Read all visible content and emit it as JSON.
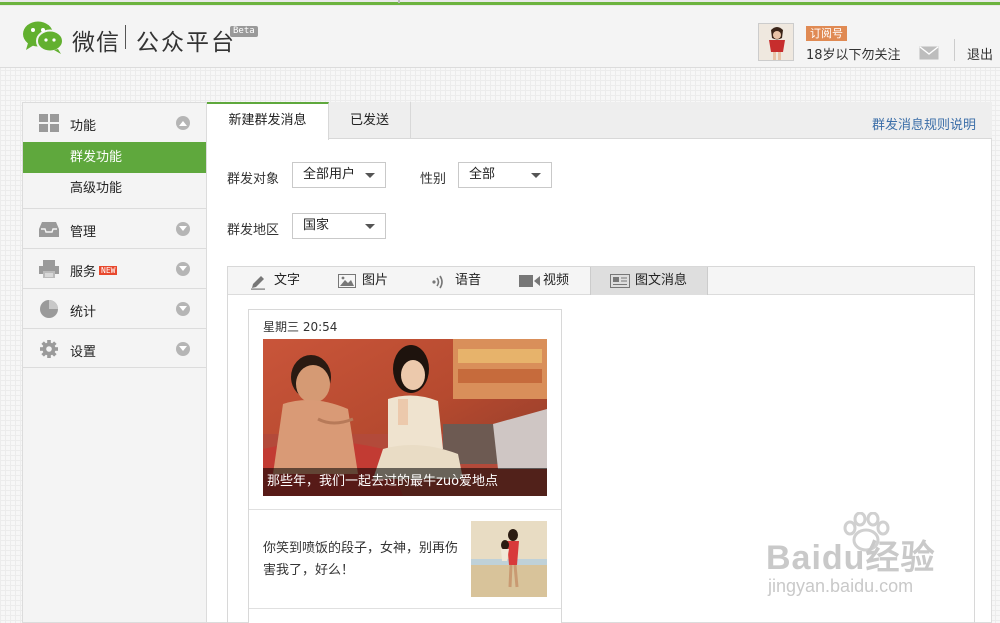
{
  "header": {
    "brand": "微信",
    "platform": "公众平台",
    "beta": "Beta",
    "account_type_badge": "订阅号",
    "account_name": "18岁以下勿关注",
    "logout": "退出"
  },
  "sidebar": {
    "groups": [
      {
        "label": "功能",
        "icon": "grid-icon",
        "items": [
          "群发功能",
          "高级功能"
        ],
        "active_item": "群发功能"
      },
      {
        "label": "管理",
        "icon": "inbox-icon"
      },
      {
        "label": "服务",
        "icon": "printer-icon",
        "tag": "NEW"
      },
      {
        "label": "统计",
        "icon": "pie-chart-icon"
      },
      {
        "label": "设置",
        "icon": "gear-icon"
      }
    ]
  },
  "main": {
    "tabs": [
      "新建群发消息",
      "已发送"
    ],
    "active_tab": "新建群发消息",
    "rules_link": "群发消息规则说明",
    "form": {
      "target_label": "群发对象",
      "target_value": "全部用户",
      "gender_label": "性别",
      "gender_value": "全部",
      "region_label": "群发地区",
      "region_value": "国家"
    },
    "composer_tabs": [
      {
        "label": "文字",
        "icon": "pencil-icon"
      },
      {
        "label": "图片",
        "icon": "image-icon"
      },
      {
        "label": "语音",
        "icon": "sound-icon"
      },
      {
        "label": "视频",
        "icon": "video-icon"
      },
      {
        "label": "图文消息",
        "icon": "news-icon"
      }
    ],
    "active_composer_tab": "图文消息",
    "card": {
      "time": "星期三 20:54",
      "cover_caption": "那些年，我们一起去过的最牛zuò爱地点",
      "sub_article_text": "你笑到喷饭的段子，女神，别再伤害我了，好么！"
    }
  },
  "watermark": {
    "logo": "Baidu经验",
    "url": "jingyan.baidu.com"
  },
  "colors": {
    "accent_green": "#5fa83d",
    "link_blue": "#3b6ea8",
    "badge_orange": "#e08a53"
  }
}
